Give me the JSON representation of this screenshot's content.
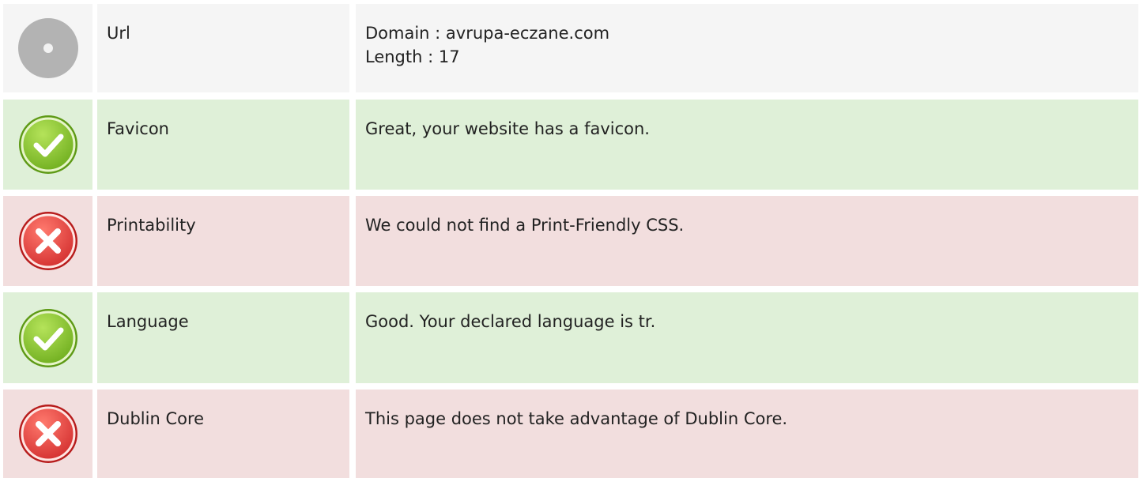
{
  "rows": [
    {
      "status": "neutral",
      "icon": "neutral-dot-icon",
      "name": "Url",
      "lines": [
        "Domain : avrupa-eczane.com",
        "Length : 17"
      ]
    },
    {
      "status": "pass",
      "icon": "check-icon",
      "name": "Favicon",
      "lines": [
        "Great, your website has a favicon."
      ]
    },
    {
      "status": "fail",
      "icon": "cross-icon",
      "name": "Printability",
      "lines": [
        "We could not find a Print-Friendly CSS."
      ]
    },
    {
      "status": "pass",
      "icon": "check-icon",
      "name": "Language",
      "lines": [
        "Good. Your declared language is tr."
      ]
    },
    {
      "status": "fail",
      "icon": "cross-icon",
      "name": "Dublin Core",
      "lines": [
        "This page does not take advantage of Dublin Core."
      ]
    }
  ],
  "colors": {
    "pass_bg": "#dff0d8",
    "fail_bg": "#f2dede",
    "neutral_bg": "#f5f5f5",
    "pass_icon": "#8cc63f",
    "fail_icon": "#e53935",
    "neutral_icon": "#b3b3b3"
  }
}
